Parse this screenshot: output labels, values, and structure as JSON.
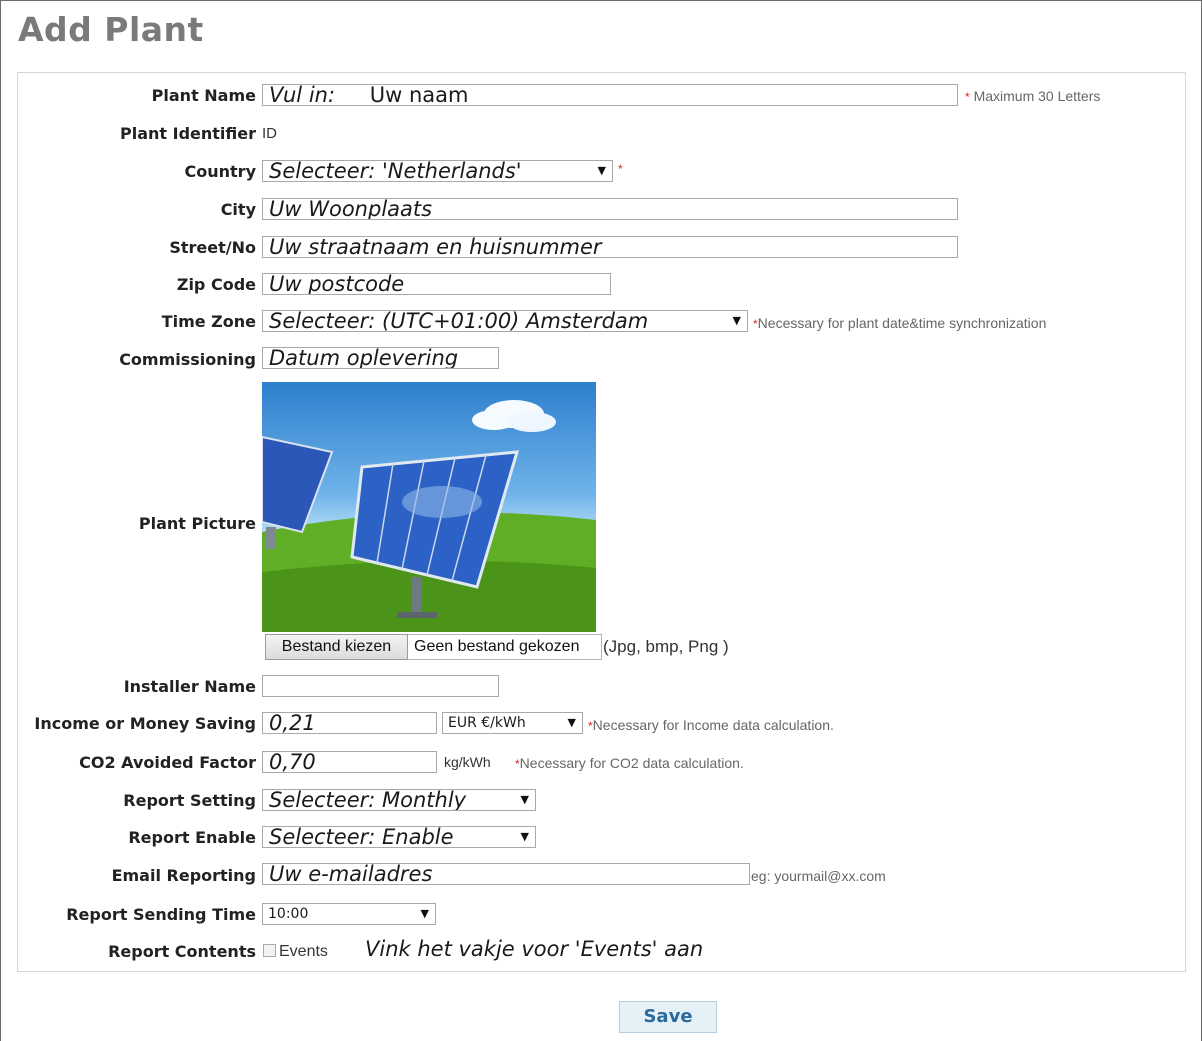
{
  "page": {
    "title": "Add Plant"
  },
  "form": {
    "plant_name": {
      "label": "Plant Name",
      "value": "Vul in:",
      "value2": "Uw naam",
      "note": "Maximum 30 Letters"
    },
    "plant_identifier": {
      "label": "Plant Identifier",
      "value": "ID"
    },
    "country": {
      "label": "Country",
      "value": "Selecteer: 'Netherlands'"
    },
    "city": {
      "label": "City",
      "value": "Uw Woonplaats"
    },
    "street": {
      "label": "Street/No",
      "value": "Uw straatnaam en huisnummer"
    },
    "zip": {
      "label": "Zip Code",
      "value": "Uw postcode"
    },
    "timezone": {
      "label": "Time Zone",
      "value": "Selecteer: (UTC+01:00) Amsterdam",
      "note": "Necessary for plant date&time synchronization"
    },
    "commissioning": {
      "label": "Commissioning",
      "value": "Datum oplevering"
    },
    "picture": {
      "label": "Plant Picture",
      "button": "Bestand kiezen",
      "filename": "Geen bestand gekozen",
      "formats": "(Jpg, bmp, Png )"
    },
    "installer": {
      "label": "Installer Name",
      "value": ""
    },
    "income": {
      "label": "Income or Money Saving",
      "value": "0,21",
      "unit": "EUR €/kWh",
      "note": "Necessary for Income data calculation."
    },
    "co2": {
      "label": "CO2 Avoided Factor",
      "value": "0,70",
      "unit": "kg/kWh",
      "note": "Necessary for CO2 data calculation."
    },
    "report_setting": {
      "label": "Report Setting",
      "value": "Selecteer: Monthly"
    },
    "report_enable": {
      "label": "Report Enable",
      "value": "Selecteer: Enable"
    },
    "email": {
      "label": "Email Reporting",
      "value": "Uw e-mailadres",
      "note": "eg: yourmail@xx.com"
    },
    "send_time": {
      "label": "Report Sending Time",
      "value": "10:00"
    },
    "contents": {
      "label": "Report Contents",
      "checkbox_label": "Events",
      "hint": "Vink het vakje voor 'Events' aan"
    }
  },
  "buttons": {
    "save": "Save"
  },
  "icons": {
    "dropdown": "▼",
    "required": "*"
  }
}
